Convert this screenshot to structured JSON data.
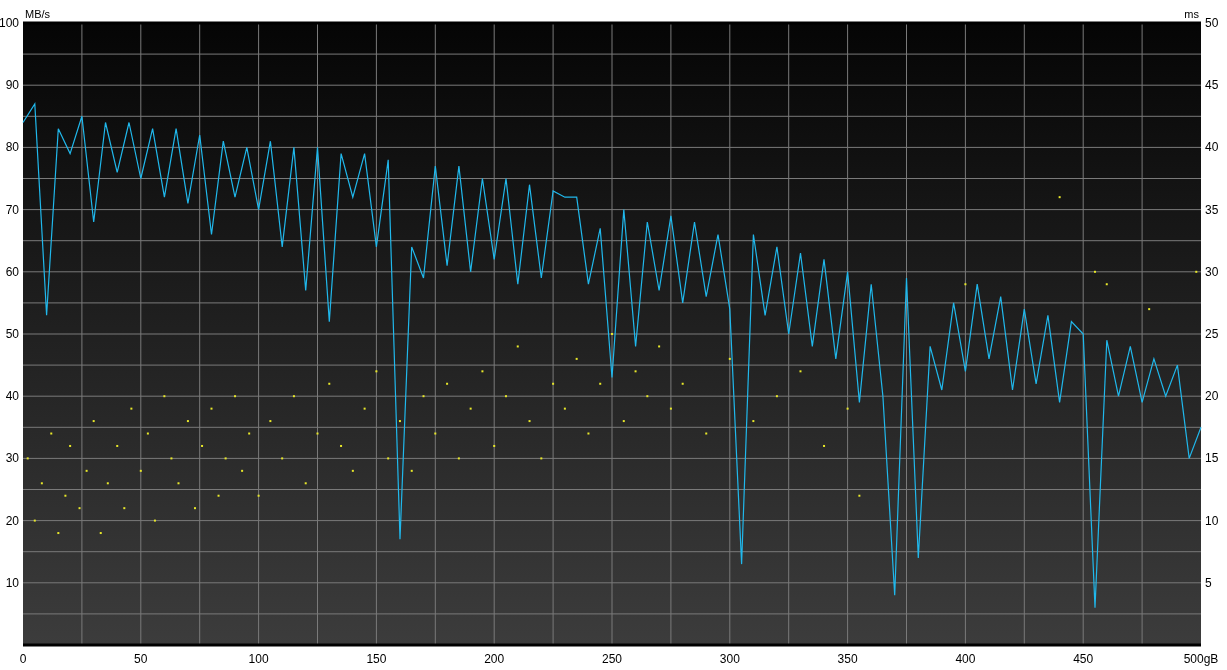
{
  "chart_data": {
    "type": "line",
    "grid": true,
    "ylabel": "MB/s",
    "y2label": "ms",
    "xlim": [
      0,
      500
    ],
    "ylim": [
      0,
      100
    ],
    "y2lim": [
      0,
      50
    ],
    "xticks": [
      0,
      50,
      100,
      150,
      200,
      250,
      300,
      350,
      400,
      450,
      {
        "value": 500,
        "label": "500gB"
      }
    ],
    "yticks": [
      10,
      20,
      30,
      40,
      50,
      60,
      70,
      80,
      90,
      100
    ],
    "y2ticks": [
      5,
      10,
      15,
      20,
      25,
      30,
      35,
      40,
      45,
      50
    ],
    "x": [
      0,
      5,
      10,
      15,
      20,
      25,
      30,
      35,
      40,
      45,
      50,
      55,
      60,
      65,
      70,
      75,
      80,
      85,
      90,
      95,
      100,
      105,
      110,
      115,
      120,
      125,
      130,
      135,
      140,
      145,
      150,
      155,
      160,
      165,
      170,
      175,
      180,
      185,
      190,
      195,
      200,
      205,
      210,
      215,
      220,
      225,
      230,
      235,
      240,
      245,
      250,
      255,
      260,
      265,
      270,
      275,
      280,
      285,
      290,
      295,
      300,
      305,
      310,
      315,
      320,
      325,
      330,
      335,
      340,
      345,
      350,
      355,
      360,
      365,
      370,
      375,
      380,
      385,
      390,
      395,
      400,
      405,
      410,
      415,
      420,
      425,
      430,
      435,
      440,
      445,
      450,
      455,
      460,
      465,
      470,
      475,
      480,
      485,
      490,
      495,
      500
    ],
    "series": [
      {
        "type": "line",
        "color": "#20b8ec",
        "values": [
          84,
          87,
          53,
          83,
          79,
          85,
          68,
          84,
          76,
          84,
          75,
          83,
          72,
          83,
          71,
          82,
          66,
          81,
          72,
          80,
          70,
          81,
          64,
          80,
          57,
          80,
          52,
          79,
          72,
          79,
          64,
          78,
          17,
          64,
          59,
          77,
          61,
          77,
          60,
          75,
          62,
          75,
          58,
          74,
          59,
          73,
          72,
          72,
          58,
          67,
          43,
          70,
          48,
          68,
          57,
          69,
          55,
          68,
          56,
          66,
          54,
          13,
          66,
          53,
          64,
          50,
          63,
          48,
          62,
          46,
          60,
          39,
          58,
          40,
          8,
          59,
          14,
          48,
          41,
          55,
          44,
          58,
          46,
          56,
          41,
          54,
          42,
          53,
          39,
          52,
          50,
          6,
          49,
          40,
          48,
          39,
          46,
          40,
          45,
          30,
          35
        ]
      },
      {
        "type": "scatter",
        "axis": "y2",
        "color": "#e8e82a",
        "x": [
          2,
          5,
          8,
          12,
          15,
          18,
          20,
          24,
          27,
          30,
          33,
          36,
          40,
          43,
          46,
          50,
          53,
          56,
          60,
          63,
          66,
          70,
          73,
          76,
          80,
          83,
          86,
          90,
          93,
          96,
          100,
          105,
          110,
          115,
          120,
          125,
          130,
          135,
          140,
          145,
          150,
          155,
          160,
          165,
          170,
          175,
          180,
          185,
          190,
          195,
          200,
          205,
          210,
          215,
          220,
          225,
          230,
          235,
          240,
          245,
          250,
          255,
          260,
          265,
          270,
          275,
          280,
          290,
          300,
          310,
          320,
          330,
          340,
          350,
          355,
          400,
          440,
          455,
          460,
          478,
          498
        ],
        "values": [
          15,
          10,
          13,
          17,
          9,
          12,
          16,
          11,
          14,
          18,
          9,
          13,
          16,
          11,
          19,
          14,
          17,
          10,
          20,
          15,
          13,
          18,
          11,
          16,
          19,
          12,
          15,
          20,
          14,
          17,
          12,
          18,
          15,
          20,
          13,
          17,
          21,
          16,
          14,
          19,
          22,
          15,
          18,
          14,
          20,
          17,
          21,
          15,
          19,
          22,
          16,
          20,
          24,
          18,
          15,
          21,
          19,
          23,
          17,
          21,
          25,
          18,
          22,
          20,
          24,
          19,
          21,
          17,
          23,
          18,
          20,
          22,
          16,
          19,
          12,
          29,
          36,
          30,
          29,
          27,
          30
        ]
      }
    ]
  }
}
